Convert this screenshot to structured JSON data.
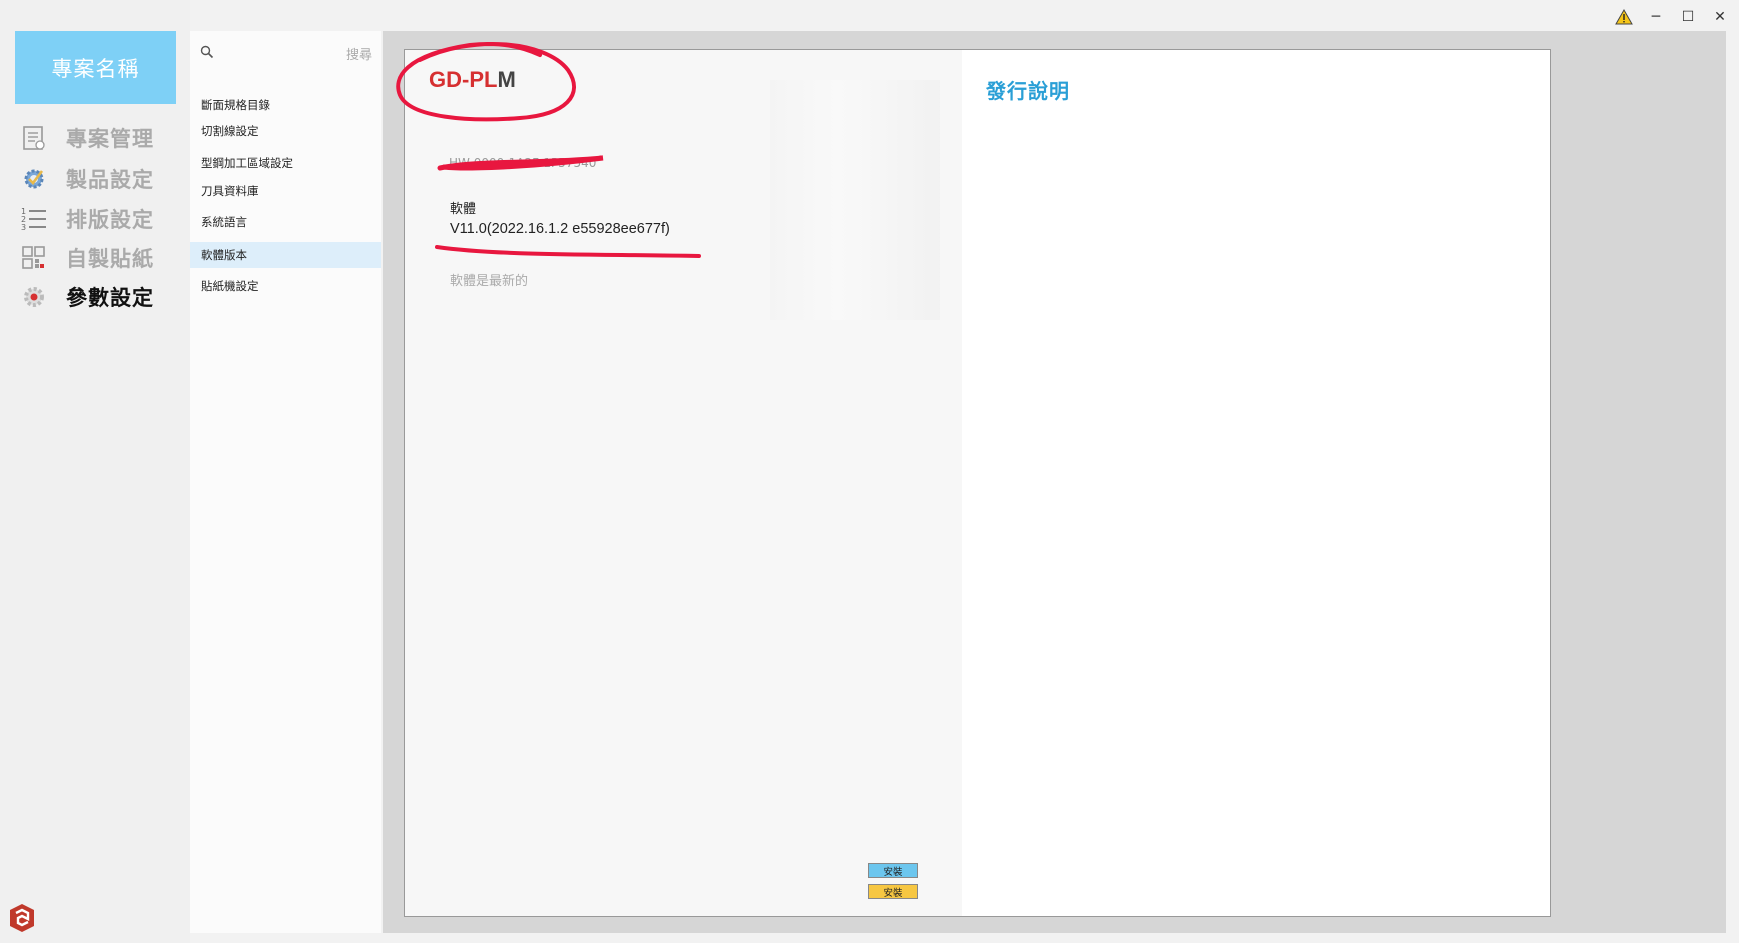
{
  "window": {
    "controls": {
      "warning": "warning-icon",
      "minimize": "─",
      "maximize": "☐",
      "close": "✕"
    }
  },
  "sidebar": {
    "project_name": "專案名稱",
    "items": [
      {
        "label": "專案管理",
        "icon": "document-list-icon"
      },
      {
        "label": "製品設定",
        "icon": "gear-check-icon"
      },
      {
        "label": "排版設定",
        "icon": "numbered-list-icon"
      },
      {
        "label": "自製貼紙",
        "icon": "grid-tiles-icon"
      },
      {
        "label": "參數設定",
        "icon": "gear-icon",
        "active": true
      }
    ]
  },
  "submenu": {
    "search_placeholder": "搜尋",
    "items": [
      {
        "label": "斷面規格目錄"
      },
      {
        "label": "切割線設定"
      },
      {
        "label": "型鋼加工區域設定"
      },
      {
        "label": "刀具資料庫"
      },
      {
        "label": "系統語言"
      },
      {
        "label": "軟體版本",
        "active": true
      },
      {
        "label": "貼紙機設定"
      }
    ]
  },
  "main": {
    "logo_prefix": "GD-P",
    "logo_l": "L",
    "logo_suffix": "M",
    "hardware_id": "HW-0000-1A2F-1P57540",
    "software_label": "軟體",
    "software_version": "V11.0(2022.16.1.2 e55928ee677f)",
    "update_status": "軟體是最新的",
    "install_button_1": "安裝",
    "install_button_2": "安裝",
    "release_notes_title": "發行說明"
  },
  "colors": {
    "accent": "#7ed0f6",
    "release_title": "#2a9fd6",
    "logo_red": "#d63031",
    "annotation_red": "#e8173f",
    "button_blue": "#6cc6ee",
    "button_yellow": "#f7c742"
  }
}
